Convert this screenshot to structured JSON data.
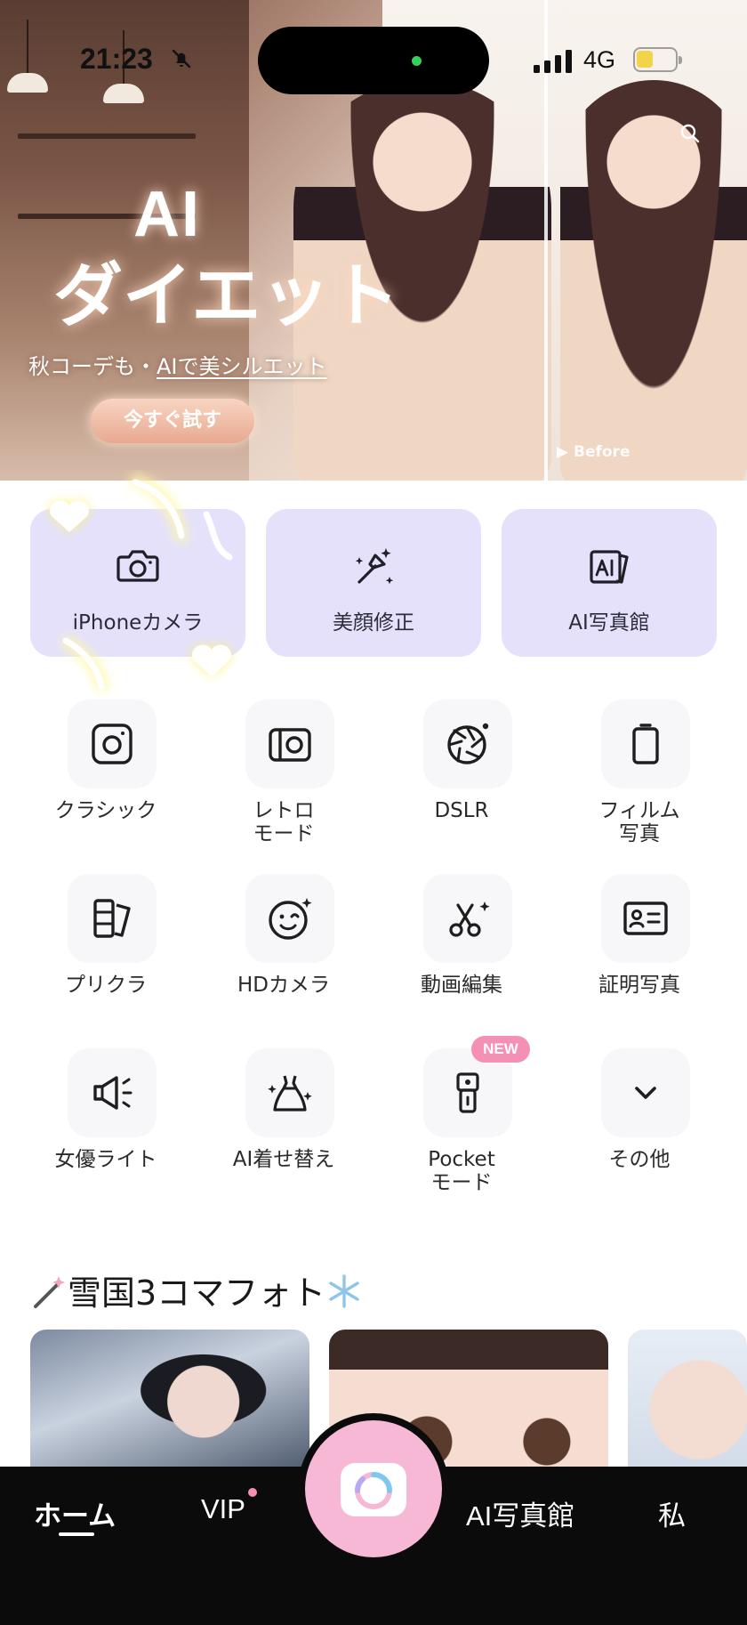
{
  "status_bar": {
    "time": "21:23",
    "network": "4G"
  },
  "banner": {
    "title_line1": "AI",
    "title_line2": "ダイエット",
    "subtitle_prefix": "秋コーデも・",
    "subtitle_emphasis": "AIで美シルエット",
    "cta_label": "今すぐ試す",
    "before_label": "▶ Before"
  },
  "feature_cards": [
    {
      "label": "iPhoneカメラ",
      "icon": "camera-icon"
    },
    {
      "label": "美顔修正",
      "icon": "makeup-brush-icon"
    },
    {
      "label": "AI写真館",
      "icon": "ai-photo-icon"
    }
  ],
  "tools": [
    {
      "label": "クラシック",
      "icon": "classic-camera-icon"
    },
    {
      "label": "レトロ\nモード",
      "icon": "retro-camera-icon"
    },
    {
      "label": "DSLR",
      "icon": "aperture-icon"
    },
    {
      "label": "フィルム\n写真",
      "icon": "film-icon"
    },
    {
      "label": "プリクラ",
      "icon": "photo-strip-icon"
    },
    {
      "label": "HDカメラ",
      "icon": "smile-face-icon"
    },
    {
      "label": "動画編集",
      "icon": "scissors-icon"
    },
    {
      "label": "証明写真",
      "icon": "id-card-icon"
    },
    {
      "label": "女優ライト",
      "icon": "spotlight-icon"
    },
    {
      "label": "AI着せ替え",
      "icon": "dress-icon"
    },
    {
      "label": "Pocket\nモード",
      "icon": "pocket-camera-icon"
    },
    {
      "label": "その他",
      "icon": "chevron-down-icon"
    }
  ],
  "new_badge": "NEW",
  "section": {
    "title": "雪国3コマフォト"
  },
  "bottom_nav": {
    "home": "ホーム",
    "vip": "VIP",
    "gallery": "AI写真館",
    "me": "私"
  },
  "colors": {
    "card_bg": "#e5e1fb",
    "tile_bg": "#f7f7f9",
    "accent_pink": "#f48fb5",
    "fab_pink": "#f6b8d4",
    "nav_bg": "#0b0b0b"
  }
}
